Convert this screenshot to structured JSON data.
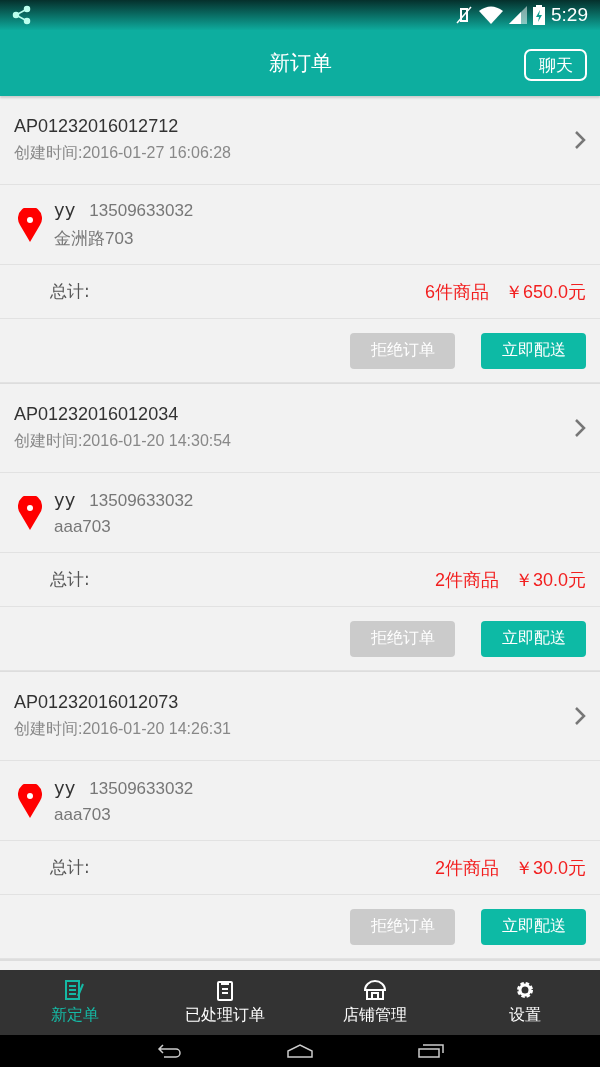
{
  "status_bar": {
    "time": "5:29"
  },
  "header": {
    "title": "新订单",
    "chat_button": "聊天"
  },
  "orders": [
    {
      "order_no": "AP01232016012712",
      "created": "创建时间:2016-01-27 16:06:28",
      "name": "yy",
      "phone": "13509633032",
      "address": "金洲路703",
      "total_label": "总计:",
      "count": "6件商品",
      "amount": "￥650.0元",
      "reject": "拒绝订单",
      "deliver": "立即配送"
    },
    {
      "order_no": "AP01232016012034",
      "created": "创建时间:2016-01-20 14:30:54",
      "name": "yy",
      "phone": "13509633032",
      "address": "aaa703",
      "total_label": "总计:",
      "count": "2件商品",
      "amount": "￥30.0元",
      "reject": "拒绝订单",
      "deliver": "立即配送"
    },
    {
      "order_no": "AP01232016012073",
      "created": "创建时间:2016-01-20 14:26:31",
      "name": "yy",
      "phone": "13509633032",
      "address": "aaa703",
      "total_label": "总计:",
      "count": "2件商品",
      "amount": "￥30.0元",
      "reject": "拒绝订单",
      "deliver": "立即配送"
    }
  ],
  "tabs": [
    {
      "label": "新定单",
      "kind": "new",
      "selected": true
    },
    {
      "label": "已处理订单",
      "kind": "done",
      "selected": false
    },
    {
      "label": "店铺管理",
      "kind": "shop",
      "selected": false
    },
    {
      "label": "设置",
      "kind": "settings",
      "selected": false
    }
  ]
}
